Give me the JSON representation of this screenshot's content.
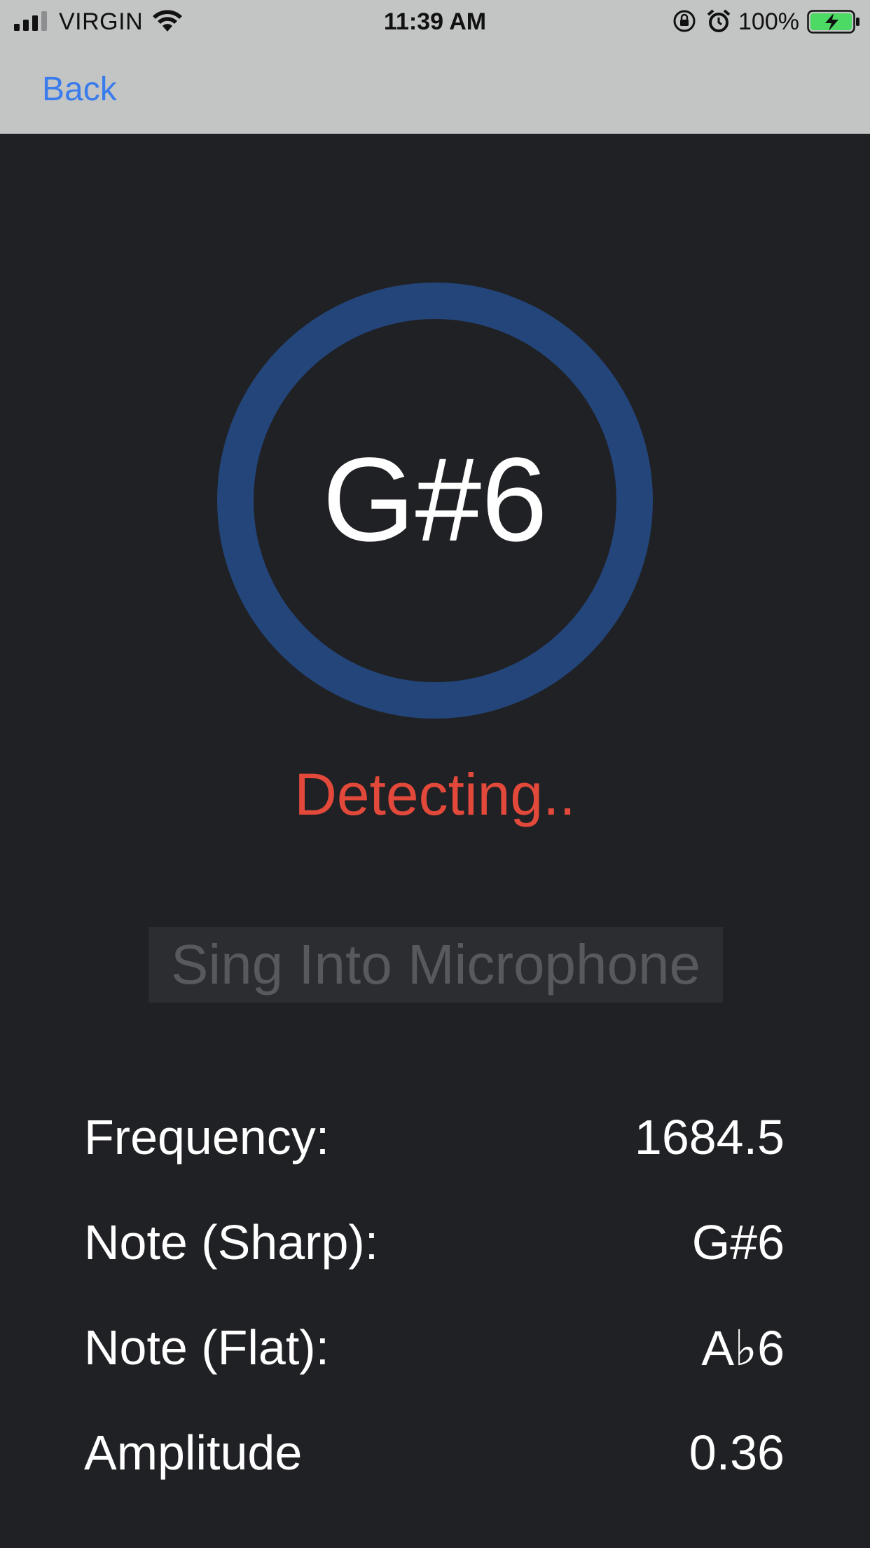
{
  "status_bar": {
    "carrier": "VIRGIN",
    "time": "11:39 AM",
    "battery_percent": "100%"
  },
  "nav": {
    "back_label": "Back"
  },
  "tuner": {
    "current_note": "G#6",
    "status_text": "Detecting..",
    "prompt": "Sing Into Microphone"
  },
  "readouts": [
    {
      "label": "Frequency:",
      "value": "1684.5"
    },
    {
      "label": "Note (Sharp):",
      "value": "G#6"
    },
    {
      "label": "Note (Flat):",
      "value": "A♭6"
    },
    {
      "label": "Amplitude",
      "value": "0.36"
    }
  ],
  "colors": {
    "accent_blue": "#3a7cec",
    "ring": "#23457a",
    "status_red": "#e2493a",
    "background": "#202124",
    "nav_bar": "#c3c4c4",
    "battery_green": "#4cd964"
  }
}
